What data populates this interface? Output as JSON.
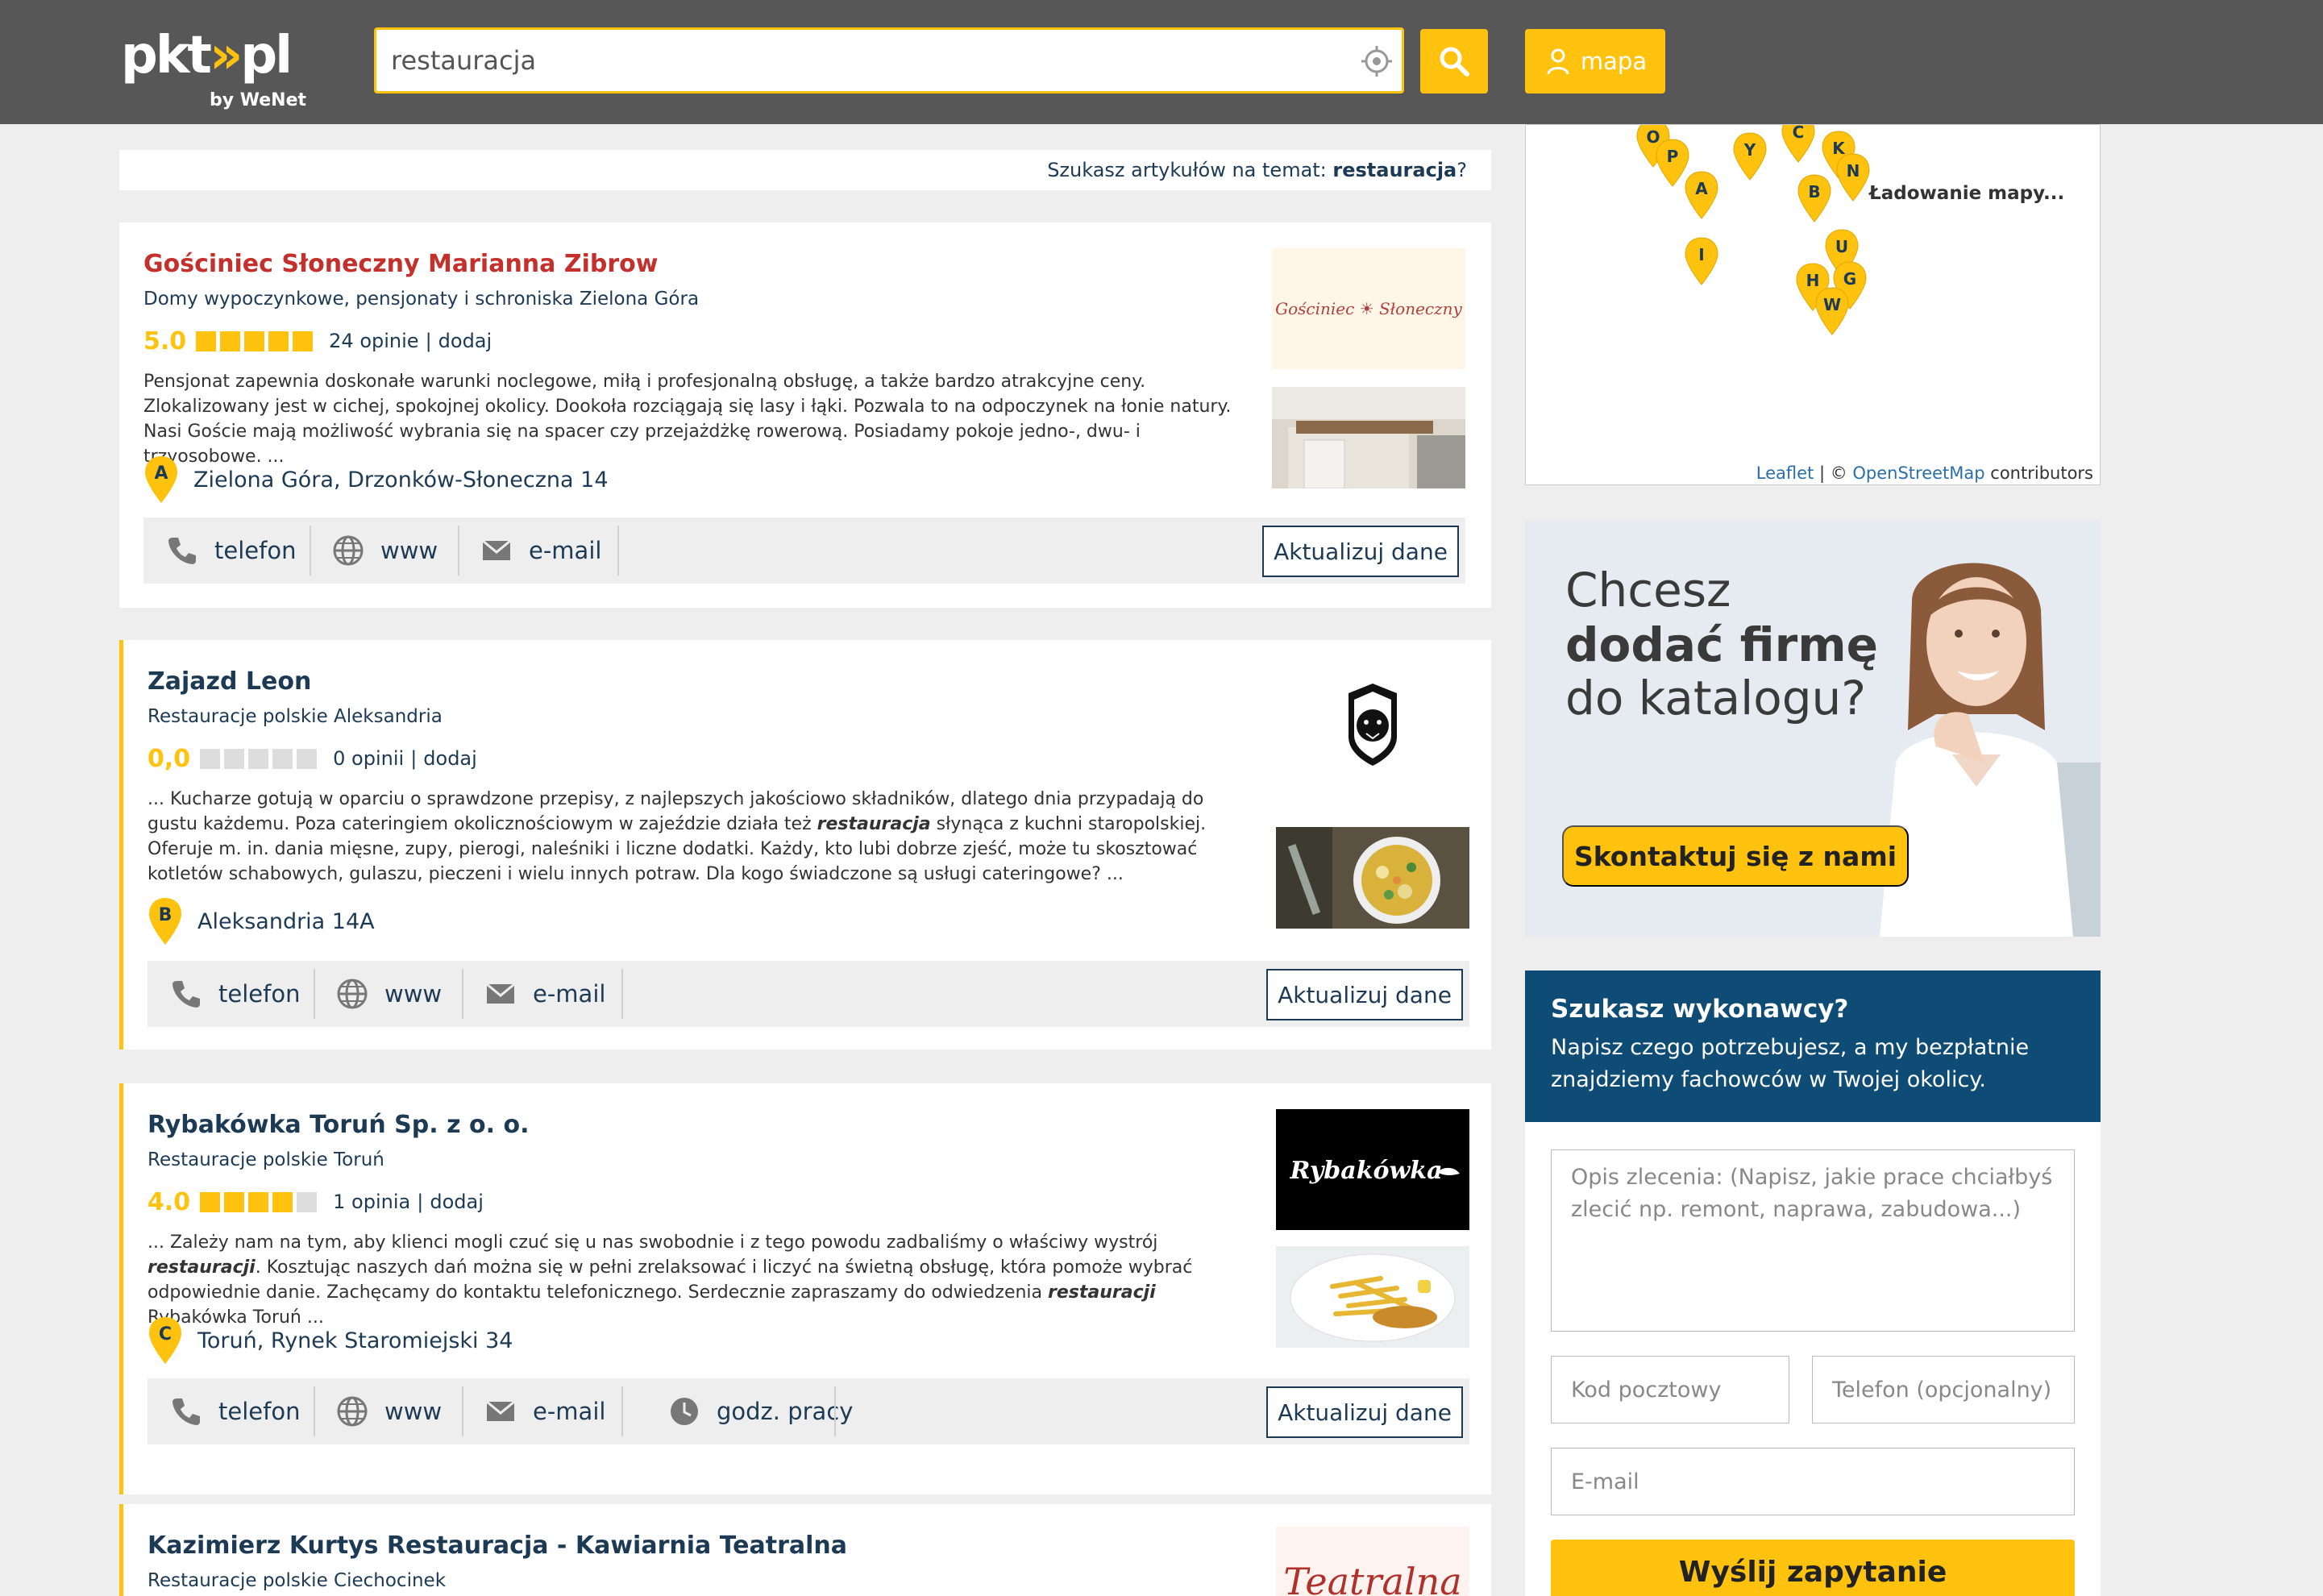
{
  "header": {
    "logo": {
      "name": "pkt",
      "tld": "pl",
      "by": "by WeNet"
    },
    "search": {
      "value": "restauracja"
    },
    "map_button": {
      "label": "mapa"
    }
  },
  "article_prompt": {
    "prefix": "Szukasz artykułów na temat: ",
    "term": "restauracja",
    "suffix": "?"
  },
  "listings": [
    {
      "name": "Gościniec Słoneczny Marianna Zibrow",
      "category": "Domy wypoczynkowe, pensjonaty i schroniska Zielona Góra",
      "rating": "5.0",
      "stars": 5,
      "reviews": "24 opinie",
      "add": "dodaj",
      "description": [
        "Pensjonat zapewnia doskonałe warunki noclegowe, miłą i profesjonalną obsługę, a także bardzo atrakcyjne ceny. Zlokalizowany jest w cichej, spokojnej okolicy. Dookoła rozciągają się lasy i łąki. Pozwala to na odpoczynek na łonie natury. Nasi Goście mają możliwość wybrania się na spacer czy przejażdżkę rowerową. Posiadamy pokoje jedno-, dwu- i trzyosobowe. ..."
      ],
      "marker": "A",
      "address": "Zielona Góra, Drzonków-Słoneczna 14",
      "actions": [
        "telefon",
        "www",
        "e-mail"
      ],
      "update_label": "Aktualizuj dane",
      "logo_text": "Gościniec ☀ Słoneczny"
    },
    {
      "name": "Zajazd Leon",
      "category": "Restauracje polskie Aleksandria",
      "rating": "0,0",
      "stars": 0,
      "reviews": "0 opinii",
      "add": "dodaj",
      "description": [
        "... Kucharze gotują w oparciu o sprawdzone przepisy, z najlepszych jakościowo składników, dlatego dnia przypadają do gustu każdemu. Poza cateringiem okolicznościowym w zajeździe działa też ",
        "restauracja",
        " słynąca z kuchni staropolskiej. Oferuje m. in. dania mięsne, zupy, pierogi, naleśniki i liczne dodatki. Każdy, kto lubi dobrze zjeść, może tu skosztować kotletów schabowych, gulaszu, pieczeni i wielu innych potraw. Dla kogo świadczone są usługi cateringowe? ..."
      ],
      "marker": "B",
      "address": "Aleksandria 14A",
      "actions": [
        "telefon",
        "www",
        "e-mail"
      ],
      "update_label": "Aktualizuj dane"
    },
    {
      "name": "Rybakówka Toruń Sp. z o. o.",
      "category": "Restauracje polskie Toruń",
      "rating": "4.0",
      "stars": 4,
      "reviews": "1 opinia",
      "add": "dodaj",
      "description": [
        "... Zależy nam na tym, aby klienci mogli czuć się u nas swobodnie i z tego powodu zadbaliśmy o właściwy wystrój ",
        "restauracji",
        ". Kosztując naszych dań można się w pełni zrelaksować i liczyć na świetną obsługę, która pomoże wybrać odpowiednie danie. Zachęcamy do kontaktu telefonicznego. Serdecznie zapraszamy do odwiedzenia ",
        "restauracji",
        " Rybakówka Toruń ..."
      ],
      "marker": "C",
      "address": "Toruń, Rynek Staromiejski 34",
      "actions": [
        "telefon",
        "www",
        "e-mail",
        "godz. pracy"
      ],
      "update_label": "Aktualizuj dane",
      "logo_text": "Rybakówka"
    },
    {
      "name": "Kazimierz Kurtys Restauracja - Kawiarnia Teatralna",
      "category": "Restauracje polskie Ciechocinek",
      "logo_text": "Teatralna"
    }
  ],
  "map": {
    "loading": "Ładowanie mapy...",
    "markers": [
      "O",
      "P",
      "A",
      "Y",
      "C",
      "K",
      "N",
      "B",
      "I",
      "U",
      "H",
      "G",
      "W"
    ],
    "attribution": {
      "leaflet": "Leaflet",
      "sep": " | © ",
      "osm": "OpenStreetMap",
      "rest": " contributors"
    }
  },
  "promo": {
    "line1": "Chcesz",
    "line2": "dodać firmę",
    "line3": "do katalogu?",
    "button": "Skontaktuj się z nami"
  },
  "contact": {
    "title": "Szukasz wykonawcy?",
    "text": "Napisz czego potrzebujesz, a my bezpłatnie znajdziemy fachowców w Twojej okolicy.",
    "desc_placeholder": "Opis zlecenia: (Napisz, jakie prace chciałbyś zlecić np. remont, naprawa, zabudowa...)",
    "postal_placeholder": "Kod pocztowy",
    "phone_placeholder": "Telefon (opcjonalny)",
    "email_placeholder": "E-mail",
    "submit": "Wyślij zapytanie"
  },
  "colors": {
    "accent": "#ffc20e",
    "header_bg": "#575757",
    "navy": "#0f4c75",
    "title_red": "#c4302b"
  },
  "icons": [
    "location-crosshair-icon",
    "search-icon",
    "map-pin-user-icon",
    "phone-icon",
    "globe-icon",
    "envelope-icon",
    "clock-icon",
    "map-marker-icon"
  ]
}
